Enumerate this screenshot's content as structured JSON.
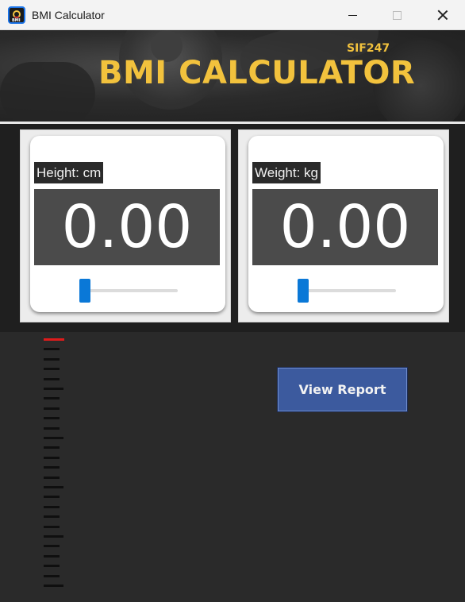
{
  "window": {
    "title": "BMI Calculator",
    "app_icon_text": "BMI"
  },
  "banner": {
    "tag": "SIF247",
    "title": "BMI CALCULATOR",
    "accent_color": "#f2c23d"
  },
  "inputs": [
    {
      "label": "Height: cm",
      "value": "0.00",
      "slider_fraction": 0.0
    },
    {
      "label": "Weight: kg",
      "value": "0.00",
      "slider_fraction": 0.0
    }
  ],
  "gauge": {
    "tick_count": 26,
    "active_index": 0,
    "active_color": "#e01b1b"
  },
  "report_button": {
    "label": "View Report",
    "color": "#3c5a9e"
  },
  "icons": {
    "minimize": "minimize-icon",
    "maximize": "maximize-icon",
    "close": "close-icon"
  }
}
